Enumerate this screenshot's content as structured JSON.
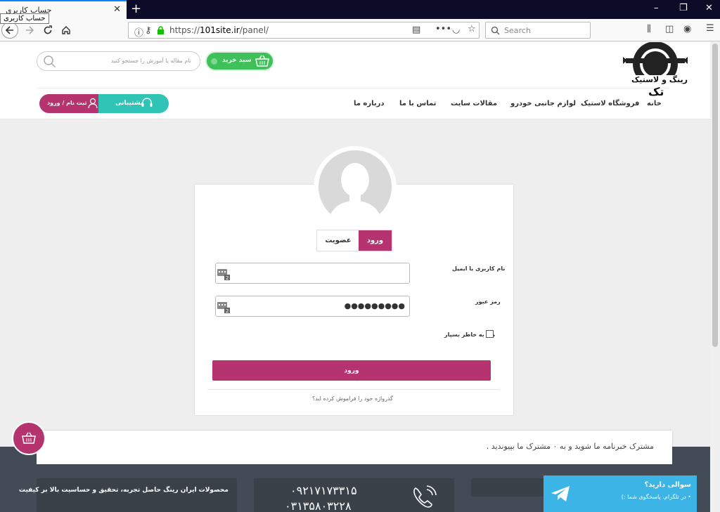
{
  "browser": {
    "tab_title": "حساب کاربری",
    "tooltip": "حساب کاربری",
    "url_prefix": "https://",
    "url_domain": "101site.ir",
    "url_path": "/panel/",
    "search_placeholder": "Search"
  },
  "header": {
    "search_placeholder": "نام مقاله یا آموزش را جستجو کنید",
    "cart_label": "سبد خرید",
    "logo_text": "رینگ و لاستیک",
    "logo_sub": "تک",
    "menu": {
      "home": "خانه",
      "tire_shop": "فروشگاه لاستیک",
      "car_parts": "لوازم جانبی خودرو",
      "articles": "مقالات سایت",
      "contact": "تماس با ما",
      "about": "درباره ما"
    },
    "support_label": "پشتیبانی",
    "register_label": "ثبت نام / ورود"
  },
  "login": {
    "tab_login": "ورود",
    "tab_member": "عضویت",
    "username_label": "نام کاربری یا ایمیل",
    "password_label": "رمز عبور",
    "password_value": "●●●●●●●●●",
    "remember_label": "مرا به خاطر بسپار",
    "submit_label": "ورود",
    "forgot_label": "گذرواژه خود را فراموش کرده اید؟"
  },
  "footer": {
    "newsletter": "مشترک خبرنامه ما شوید و به ۰ مشترک ما بپیوندید .",
    "about_text": "محصولات ایران رینگ حاصل تجربه، تحقیق و حساسیت بالا بر کیفیت",
    "phone1": "۰۹۲۱۷۱۷۳۳۱۵",
    "phone2": "۰۳۱۳۵۸۰۳۲۲۸",
    "telegram_title": "سوالی دارید؟",
    "telegram_sub": "• در تلگرام، پاسخگوی شما :)"
  }
}
